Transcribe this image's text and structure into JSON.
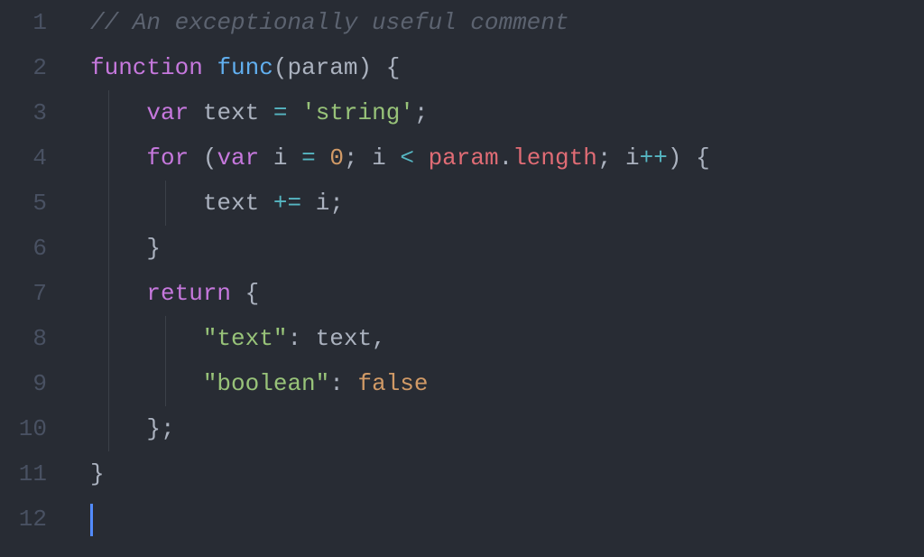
{
  "lineNumbers": [
    "1",
    "2",
    "3",
    "4",
    "5",
    "6",
    "7",
    "8",
    "9",
    "10",
    "11",
    "12"
  ],
  "code": {
    "line1": {
      "comment": "// An exceptionally useful comment"
    },
    "line2": {
      "kw_function": "function",
      "sp1": " ",
      "funcname": "func",
      "open_paren": "(",
      "param": "param",
      "close_paren": ")",
      "sp2": " ",
      "brace": "{"
    },
    "line3": {
      "indent": "    ",
      "kw_var": "var",
      "sp1": " ",
      "name": "text",
      "sp2": " ",
      "eq": "=",
      "sp3": " ",
      "str": "'string'",
      "semi": ";"
    },
    "line4": {
      "indent": "    ",
      "kw_for": "for",
      "sp1": " ",
      "open": "(",
      "kw_var": "var",
      "sp2": " ",
      "ivar": "i",
      "sp3": " ",
      "eq": "=",
      "sp4": " ",
      "zero": "0",
      "semi1": ";",
      "sp5": " ",
      "ivar2": "i",
      "sp6": " ",
      "lt": "<",
      "sp7": " ",
      "param": "param",
      "dot": ".",
      "length": "length",
      "semi2": ";",
      "sp8": " ",
      "ivar3": "i",
      "inc": "++",
      "close": ")",
      "sp9": " ",
      "brace": "{"
    },
    "line5": {
      "indent": "        ",
      "text": "text",
      "sp1": " ",
      "pluseq": "+=",
      "sp2": " ",
      "ivar": "i",
      "semi": ";"
    },
    "line6": {
      "indent": "    ",
      "brace": "}"
    },
    "line7": {
      "indent": "    ",
      "kw_return": "return",
      "sp1": " ",
      "brace": "{"
    },
    "line8": {
      "indent": "        ",
      "key": "\"text\"",
      "colon": ":",
      "sp1": " ",
      "val": "text",
      "comma": ","
    },
    "line9": {
      "indent": "        ",
      "key": "\"boolean\"",
      "colon": ":",
      "sp1": " ",
      "val": "false"
    },
    "line10": {
      "indent": "    ",
      "brace": "}",
      "semi": ";"
    },
    "line11": {
      "brace": "}"
    }
  }
}
